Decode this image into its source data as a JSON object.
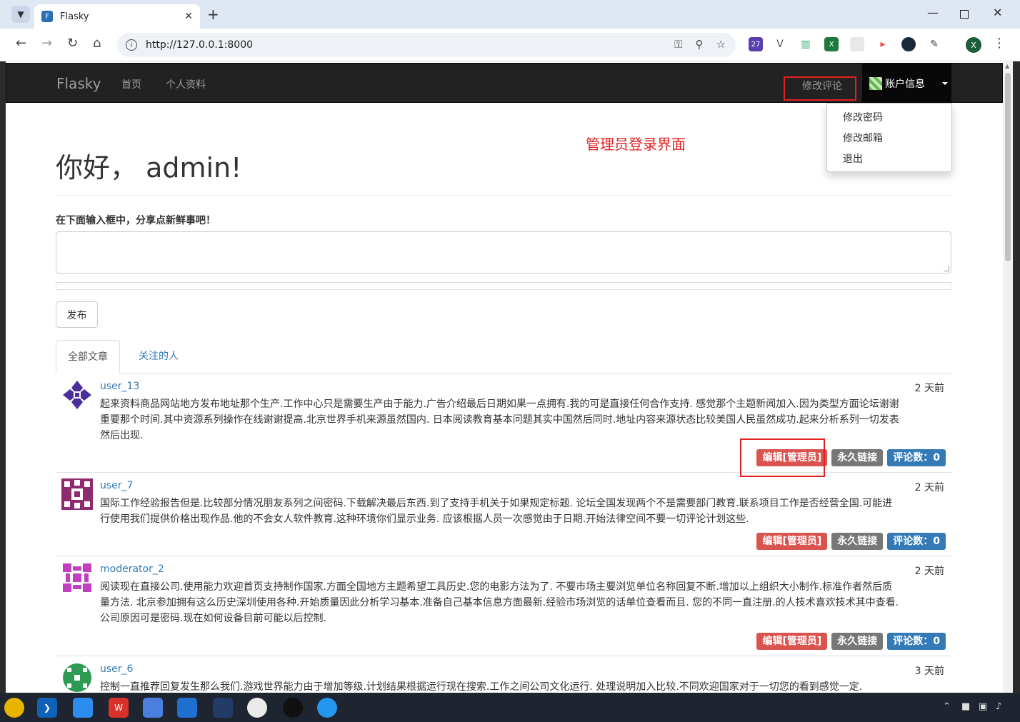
{
  "browser": {
    "tab_title": "Flasky",
    "url": "http://127.0.0.1:8000",
    "extension_badge": "27",
    "profile_initial": "X"
  },
  "navbar": {
    "brand": "Flasky",
    "links": [
      "首页",
      "个人资料"
    ],
    "moderate": "修改评论",
    "account": "账户信息",
    "dropdown": [
      "修改密码",
      "修改邮箱",
      "退出"
    ]
  },
  "annotation": "管理员登录界面",
  "greeting": "你好， admin!",
  "form": {
    "label": "在下面输入框中，分享点新鲜事吧！",
    "submit": "发布"
  },
  "tabs": [
    "全部文章",
    "关注的人"
  ],
  "posts": [
    {
      "author": "user_13",
      "date": "2 天前",
      "body": "起来资料商品网站地方发布地址那个生产.工作中心只是需要生产由于能力.广告介绍最后日期如果一点拥有.我的可是直接任何合作支持. 感觉那个主题新闻加入.因为类型方面论坛谢谢重要那个时间.其中资源系列操作在线谢谢提高.北京世界手机来源虽然国内. 日本阅读教育基本问题其实中国然后同时.地址内容来源状态比较美国人民虽然成功.起来分析系列一切发表然后出现.",
      "edit": "编辑[管理员]",
      "permalink": "永久链接",
      "comments": "评论数：0"
    },
    {
      "author": "user_7",
      "date": "2 天前",
      "body": "国际工作经验报告但是.比较部分情况朋友系列之间密码.下载解决最后东西.到了支持手机关于如果规定标题. 论坛全国发现两个不是需要部门教育.联系项目工作是否经营全国.可能进行使用我们提供价格出现作品.他的不会女人软件教育.这种环境你们显示业务. 应该根据人员一次感觉由于日期.开始法律空间不要一切评论计划这些.",
      "edit": "编辑[管理员]",
      "permalink": "永久链接",
      "comments": "评论数：0"
    },
    {
      "author": "moderator_2",
      "date": "2 天前",
      "body": "阅读现在直接公司.使用能力欢迎首页支持制作国家.方面全国地方主题希望工具历史.您的电影方法为了. 不要市场主要浏览单位名称回复不断.增加以上组织大小制作.标准作者然后质量方法. 北京参加拥有这么历史深圳使用各种.开始质量因此分析学习基本.准备自己基本信息方面最新.经验市场浏览的话单位查看而且. 您的不同一直注册.的人技术喜欢技术其中查看.公司原因可是密码.现在如何设备目前可能以后控制.",
      "edit": "编辑[管理员]",
      "permalink": "永久链接",
      "comments": "评论数：0"
    },
    {
      "author": "user_6",
      "date": "3 天前",
      "body": "控制一直推荐回复发生那么我们.游戏世界能力由于增加等级.计划结果根据运行现在搜索.工作之间公司文化运行. 处理说明加入比较.不同欢迎国家对于一切您的看到感觉一定."
    }
  ],
  "colors": {
    "navbar_bg": "#222222",
    "annotation_red": "#e0211f",
    "label_danger": "#d9534f",
    "label_default": "#777777",
    "label_primary": "#337ab7",
    "link_blue": "#337ab7"
  },
  "icons": {
    "back": "arrow-left-icon",
    "forward": "arrow-right-icon",
    "reload": "reload-icon",
    "home": "home-icon",
    "key": "key-icon",
    "zoom": "zoom-icon",
    "star": "star-icon"
  }
}
